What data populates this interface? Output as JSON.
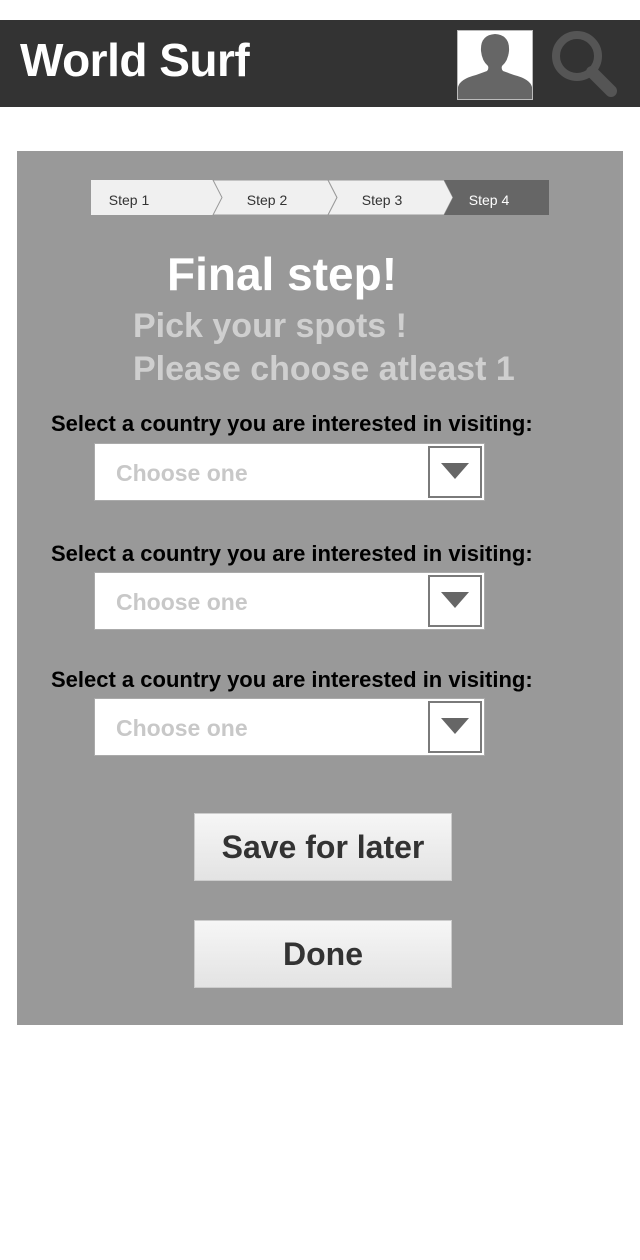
{
  "header": {
    "title": "World Surf",
    "avatar_icon": "user-avatar-icon",
    "search_icon": "search-icon",
    "bar_color": "#333333"
  },
  "wizard": {
    "steps": [
      {
        "label": "Step 1",
        "active": false
      },
      {
        "label": "Step 2",
        "active": false
      },
      {
        "label": "Step 3",
        "active": false
      },
      {
        "label": "Step 4",
        "active": true
      }
    ],
    "title": "Final step!",
    "subtitle_line1": "Pick your spots !",
    "subtitle_line2": "Please choose atleast 1",
    "fields": [
      {
        "label": "Select a country you are interested in visiting:",
        "value": "Choose one"
      },
      {
        "label": "Select a country you are interested in visiting:",
        "value": "Choose one"
      },
      {
        "label": "Select a country you are interested in visiting:",
        "value": "Choose one"
      }
    ],
    "save_label": "Save for later",
    "done_label": "Done",
    "panel_color": "#999999"
  }
}
